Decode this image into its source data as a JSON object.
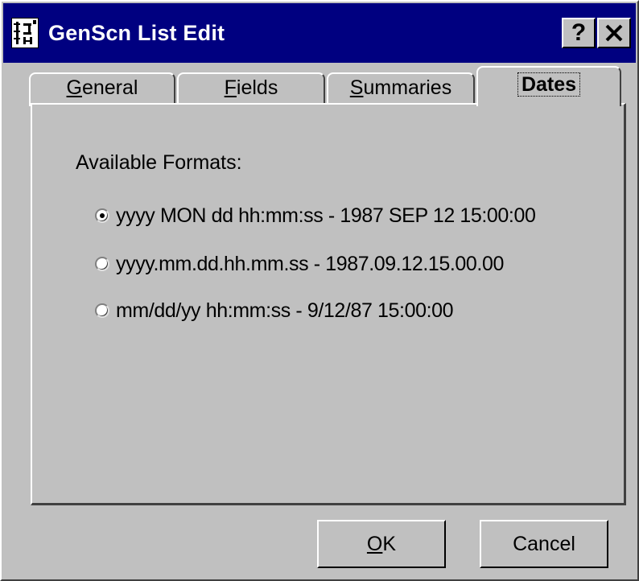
{
  "window": {
    "title": "GenScn List Edit",
    "help_button": "?",
    "close_button": "✕"
  },
  "tabs": [
    {
      "label_prefix": "",
      "mnemonic": "G",
      "label_suffix": "eneral"
    },
    {
      "label_prefix": "",
      "mnemonic": "F",
      "label_suffix": "ields"
    },
    {
      "label_prefix": "",
      "mnemonic": "S",
      "label_suffix": "ummaries"
    },
    {
      "label": "Dates",
      "active": true
    }
  ],
  "dates": {
    "formats_label": "Available Formats:",
    "options": [
      {
        "label": "yyyy MON dd hh:mm:ss - 1987 SEP 12 15:00:00",
        "checked": true
      },
      {
        "label": "yyyy.mm.dd.hh.mm.ss - 1987.09.12.15.00.00",
        "checked": false
      },
      {
        "label": "mm/dd/yy hh:mm:ss - 9/12/87 15:00:00",
        "checked": false
      }
    ]
  },
  "buttons": {
    "ok_mnemonic": "O",
    "ok_suffix": "K",
    "cancel": "Cancel"
  },
  "colors": {
    "titlebar": "#000080",
    "face": "#c0c0c0"
  }
}
